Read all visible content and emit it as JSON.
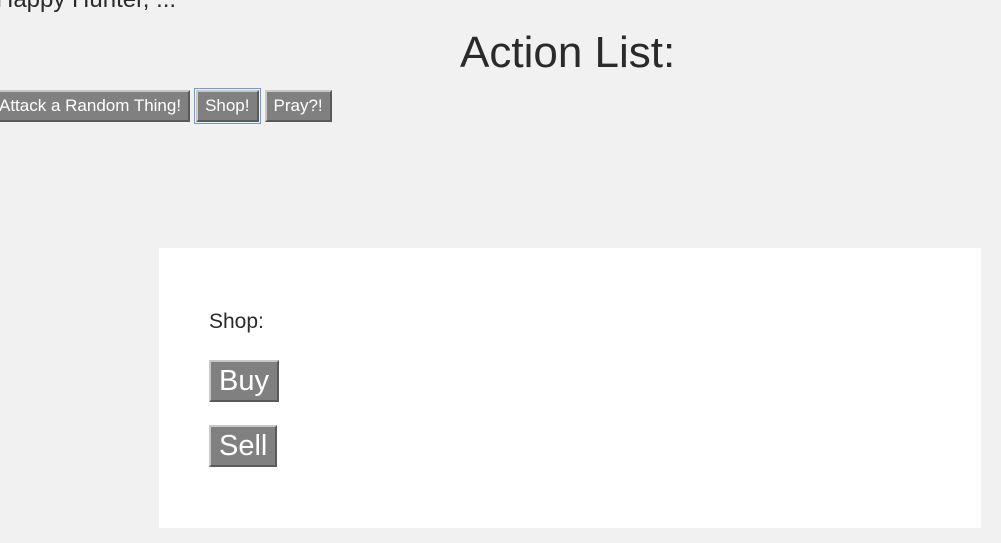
{
  "top_text": "Happy Hunter, ...",
  "actions": {
    "title": "Action List:",
    "buttons": [
      {
        "label": "Attack a Random Thing!"
      },
      {
        "label": "Shop!"
      },
      {
        "label": "Pray?!"
      }
    ]
  },
  "shop": {
    "label": "Shop:",
    "buy_label": "Buy",
    "sell_label": "Sell"
  },
  "colors": {
    "page_background": "#f1f1f1",
    "panel_background": "#ffffff",
    "button_background": "#808080",
    "button_text": "#ffffff",
    "focus_outline": "#6c9ae0"
  }
}
